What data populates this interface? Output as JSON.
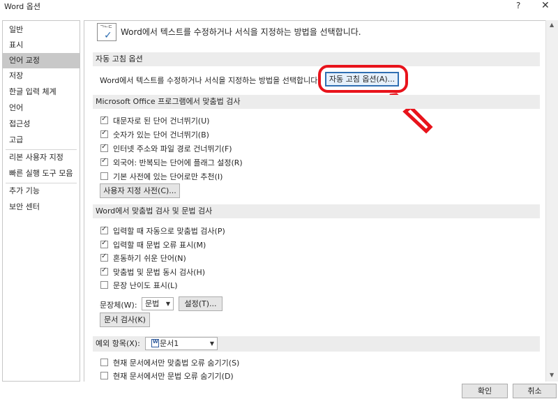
{
  "window": {
    "title": "Word 옵션",
    "help": "?",
    "close": "✕"
  },
  "sidebar": {
    "items": [
      {
        "label": "일반"
      },
      {
        "label": "표시"
      },
      {
        "label": "언어 교정"
      },
      {
        "label": "저장"
      },
      {
        "label": "한글 입력 체계"
      },
      {
        "label": "언어"
      },
      {
        "label": "접근성"
      },
      {
        "label": "고급"
      },
      {
        "label": "리본 사용자 지정"
      },
      {
        "label": "빠른 실행 도구 모음"
      },
      {
        "label": "추가 기능"
      },
      {
        "label": "보안 센터"
      }
    ],
    "selected": "언어 교정"
  },
  "header": {
    "text": "Word에서 텍스트를 수정하거나 서식을 지정하는 방법을 선택합니다.",
    "icon_text": "ᄀᄂᄃ"
  },
  "autocorrect": {
    "title": "자동 고침 옵션",
    "desc": "Word에서 텍스트를 수정하거나 서식을 지정하는 방법을 선택합니다.",
    "button": "자동 고침 옵션(A)...",
    "highlight_color": "#e8131b"
  },
  "office_spelling": {
    "title": "Microsoft Office 프로그램에서 맞춤법 검사",
    "options": [
      {
        "label": "대문자로 된 단어 건너뛰기(U)",
        "checked": true
      },
      {
        "label": "숫자가 있는 단어 건너뛰기(B)",
        "checked": true
      },
      {
        "label": "인터넷 주소와 파일 경로 건너뛰기(F)",
        "checked": true
      },
      {
        "label": "외국어: 반복되는 단어에 플래그 설정(R)",
        "checked": true
      },
      {
        "label": "기본 사전에 있는 단어로만 추천(I)",
        "checked": false
      }
    ],
    "custom_dict_button": "사용자 지정 사전(C)..."
  },
  "word_spelling": {
    "title": "Word에서 맞춤법 검사 및 문법 검사",
    "options": [
      {
        "label": "입력할 때 자동으로 맞춤법 검사(P)",
        "checked": true
      },
      {
        "label": "입력할 때 문법 오류 표시(M)",
        "checked": true
      },
      {
        "label": "혼동하기 쉬운 단어(N)",
        "checked": true
      },
      {
        "label": "맞춤법 및 문법 동시 검사(H)",
        "checked": true
      },
      {
        "label": "문장 난이도 표시(L)",
        "checked": false
      }
    ],
    "style_label": "문장체(W):",
    "style_value": "문법",
    "settings_button": "설정(T)...",
    "check_doc_button": "문서 검사(K)"
  },
  "exceptions": {
    "label": "예외 항목(X):",
    "doc_value": "문서1",
    "options": [
      {
        "label": "현재 문서에서만 맞춤법 오류 숨기기(S)",
        "checked": false
      },
      {
        "label": "현재 문서에서만 문법 오류 숨기기(D)",
        "checked": false
      }
    ]
  },
  "footer": {
    "ok": "확인",
    "cancel": "취소"
  }
}
